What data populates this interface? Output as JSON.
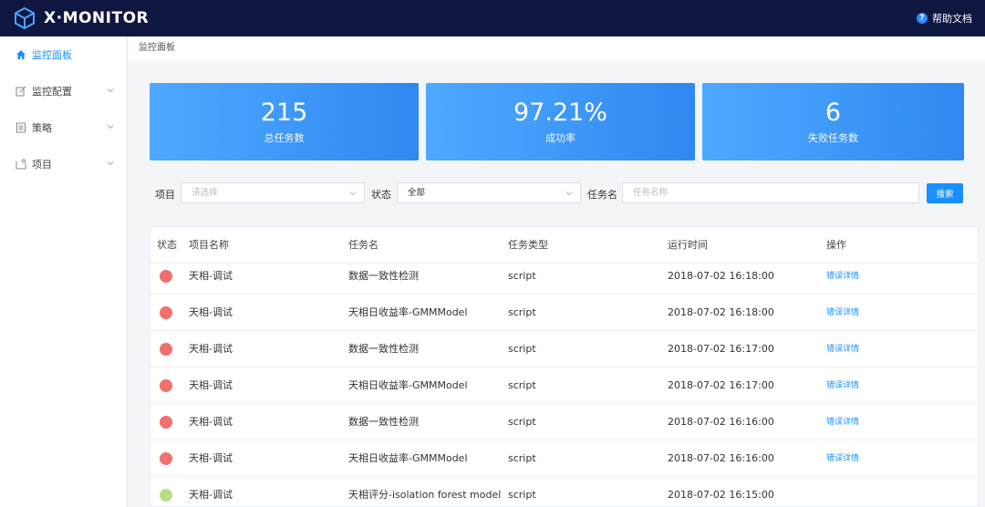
{
  "app": {
    "name": "X·MONITOR",
    "help_label": "帮助文档"
  },
  "sidebar": {
    "items": [
      {
        "label": "监控面板",
        "icon": "home-icon",
        "active": true
      },
      {
        "label": "监控配置",
        "icon": "edit-icon"
      },
      {
        "label": "策略",
        "icon": "document-icon"
      },
      {
        "label": "项目",
        "icon": "folder-icon"
      }
    ]
  },
  "breadcrumb": {
    "current": "监控面板"
  },
  "stats": [
    {
      "value": "215",
      "label": "总任务数"
    },
    {
      "value": "97.21%",
      "label": "成功率"
    },
    {
      "value": "6",
      "label": "失败任务数"
    }
  ],
  "filters": {
    "project_label": "项目",
    "project_placeholder": "请选择",
    "status_label": "状态",
    "status_value": "全部",
    "task_label": "任务名",
    "task_placeholder": "任务名称",
    "search_label": "搜索"
  },
  "table": {
    "columns": [
      "状态",
      "项目名称",
      "任务名",
      "任务类型",
      "运行时间",
      "操作"
    ],
    "rows": [
      {
        "status": "failed",
        "project": "天相-调试",
        "task": "数据一致性检测",
        "type": "script",
        "time": "2018-07-02 16:18:00",
        "action": "错误详情"
      },
      {
        "status": "failed",
        "project": "天相-调试",
        "task": "天相日收益率-GMMModel",
        "type": "script",
        "time": "2018-07-02 16:18:00",
        "action": "错误详情"
      },
      {
        "status": "failed",
        "project": "天相-调试",
        "task": "数据一致性检测",
        "type": "script",
        "time": "2018-07-02 16:17:00",
        "action": "错误详情"
      },
      {
        "status": "failed",
        "project": "天相-调试",
        "task": "天相日收益率-GMMModel",
        "type": "script",
        "time": "2018-07-02 16:17:00",
        "action": "错误详情"
      },
      {
        "status": "failed",
        "project": "天相-调试",
        "task": "数据一致性检测",
        "type": "script",
        "time": "2018-07-02 16:16:00",
        "action": "错误详情"
      },
      {
        "status": "failed",
        "project": "天相-调试",
        "task": "天相日收益率-GMMModel",
        "type": "script",
        "time": "2018-07-02 16:16:00",
        "action": "错误详情"
      },
      {
        "status": "success",
        "project": "天相-调试",
        "task": "天相评分-isolation forest model",
        "type": "script",
        "time": "2018-07-02 16:15:00",
        "action": ""
      }
    ]
  },
  "colors": {
    "failed": "#f0706e",
    "success": "#b8de85",
    "accent": "#1890ff",
    "topbar": "#0f1640"
  }
}
